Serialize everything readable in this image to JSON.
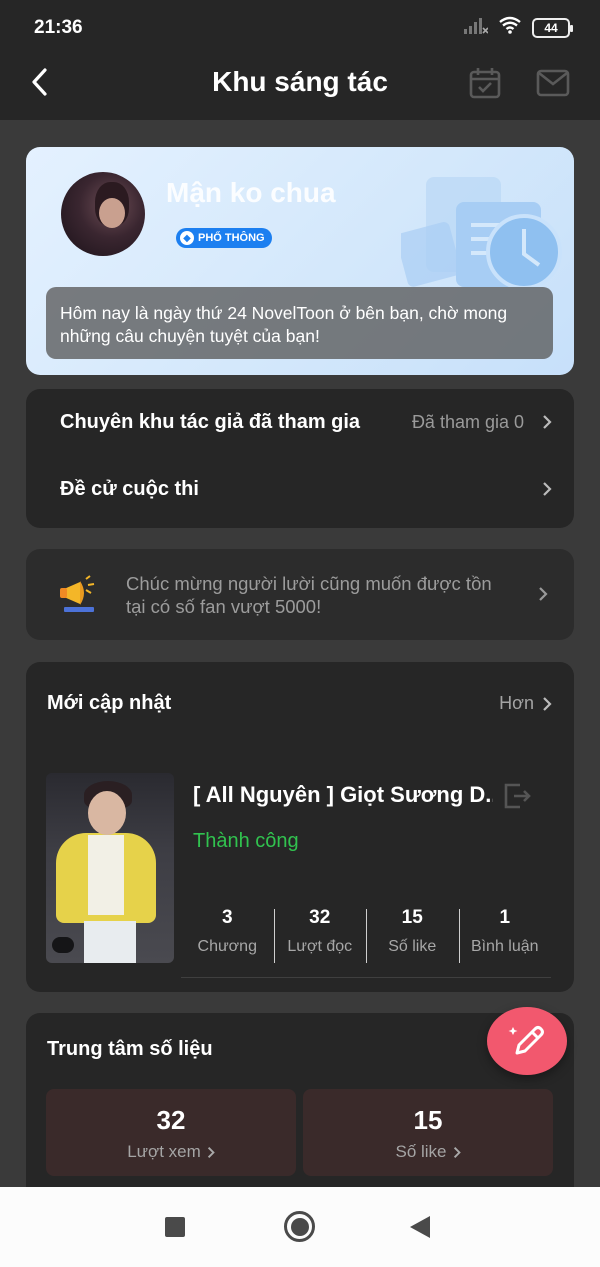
{
  "status_bar": {
    "time": "21:36",
    "battery": "44"
  },
  "header": {
    "title": "Khu sáng tác"
  },
  "profile": {
    "name": "Mận ko chua",
    "badge": "PHỔ THÔNG",
    "welcome": "Hôm nay là ngày thứ 24 NovelToon ở bên bạn, chờ mong những câu chuyện tuyệt của bạn!"
  },
  "menu": {
    "items": [
      {
        "label": "Chuyên khu tác giả đã tham gia",
        "value": "Đã tham gia 0"
      },
      {
        "label": "Đề cử cuộc thi",
        "value": ""
      }
    ]
  },
  "notice": {
    "text": "Chúc mừng người lười cũng muốn được tồn tại có số fan vượt 5000!"
  },
  "updates": {
    "title": "Mới cập nhật",
    "more": "Hơn",
    "work": {
      "title": "[ All Nguyên ] Giọt Sương D...",
      "status": "Thành công",
      "stats": [
        {
          "value": "3",
          "label": "Chương"
        },
        {
          "value": "32",
          "label": "Lượt đọc"
        },
        {
          "value": "15",
          "label": "Số like"
        },
        {
          "value": "1",
          "label": "Bình luận"
        }
      ]
    }
  },
  "data_center": {
    "title": "Trung tâm số liệu",
    "boxes": [
      {
        "value": "32",
        "label": "Lượt xem"
      },
      {
        "value": "15",
        "label": "Số like"
      }
    ]
  },
  "colors": {
    "background": "#3a3a3a",
    "card": "#262626",
    "accent_pink": "#f2586e",
    "success": "#31c24f",
    "badge_blue": "#1c7ff0"
  },
  "icons": [
    "back-icon",
    "calendar-icon",
    "mail-icon",
    "megaphone-icon",
    "export-icon",
    "pen-icon",
    "wifi-icon",
    "signal-icon"
  ]
}
